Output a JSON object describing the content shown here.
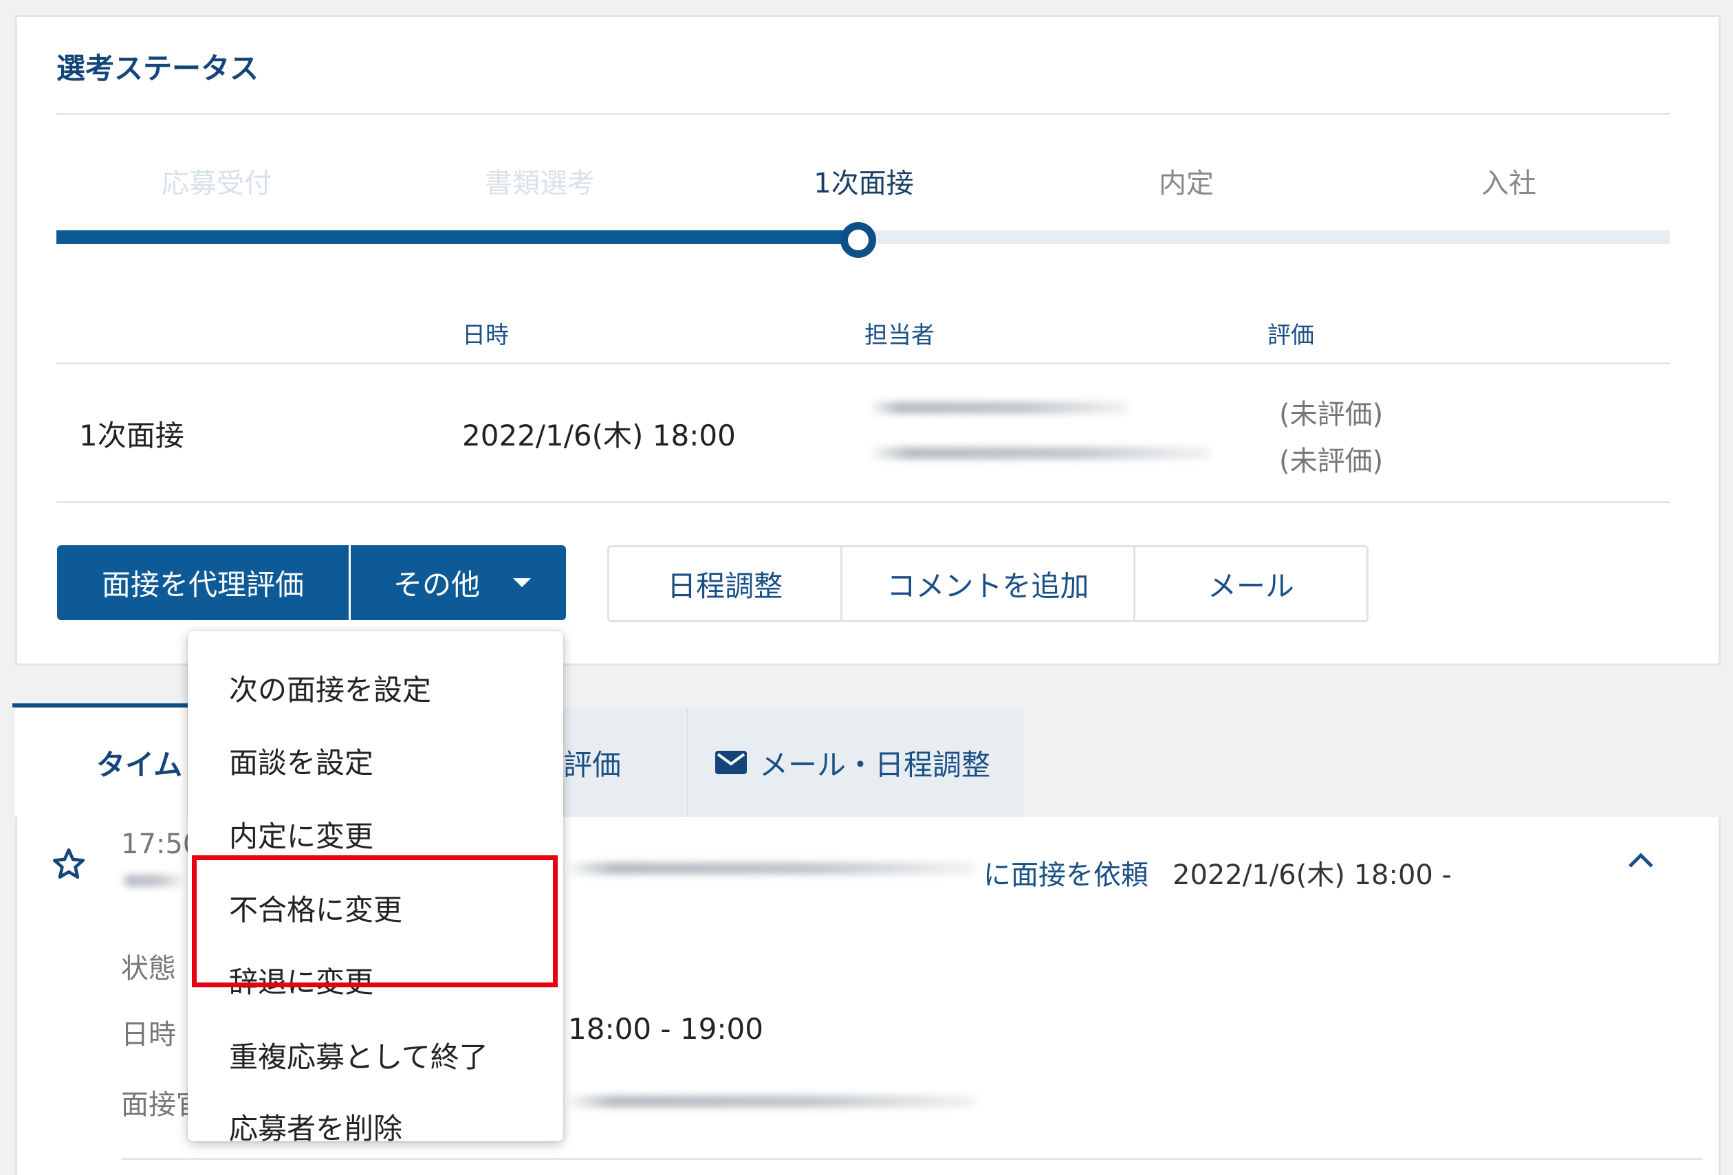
{
  "section_title": "選考ステータス",
  "steps": [
    {
      "label": "応募受付",
      "state": "done"
    },
    {
      "label": "書類選考",
      "state": "done"
    },
    {
      "label": "1次面接",
      "state": "current"
    },
    {
      "label": "内定",
      "state": "upcoming"
    },
    {
      "label": "入社",
      "state": "upcoming"
    }
  ],
  "progress_fraction": 0.497,
  "table": {
    "headers": [
      "日時",
      "担当者",
      "評価"
    ],
    "row": {
      "stage": "1次面接",
      "datetime": "2022/1/6(木) 18:00",
      "evaluations": [
        "(未評価)",
        "(未評価)"
      ]
    }
  },
  "buttons": {
    "proxy_eval": "面接を代理評価",
    "other": "その他",
    "schedule": "日程調整",
    "add_comment": "コメントを追加",
    "mail": "メール"
  },
  "tabs": {
    "timeline": "タイム",
    "evaluation": "評価",
    "mail_schedule": "メール・日程調整"
  },
  "timeline": {
    "time": "17:50",
    "request_text": "に面接を依頼",
    "request_datetime": "2022/1/6(木) 18:00 -",
    "status_label": "状態",
    "datetime_label": "日時",
    "datetime_value": "18:00 - 19:00",
    "interviewer_label": "面接官"
  },
  "dropdown": {
    "items": [
      "次の面接を設定",
      "面談を設定",
      "内定に変更",
      "不合格に変更",
      "辞退に変更",
      "重複応募として終了",
      "応募者を削除"
    ]
  },
  "colors": {
    "primary": "#0e5a96",
    "heading": "#14457a",
    "highlight": "#e60012"
  }
}
